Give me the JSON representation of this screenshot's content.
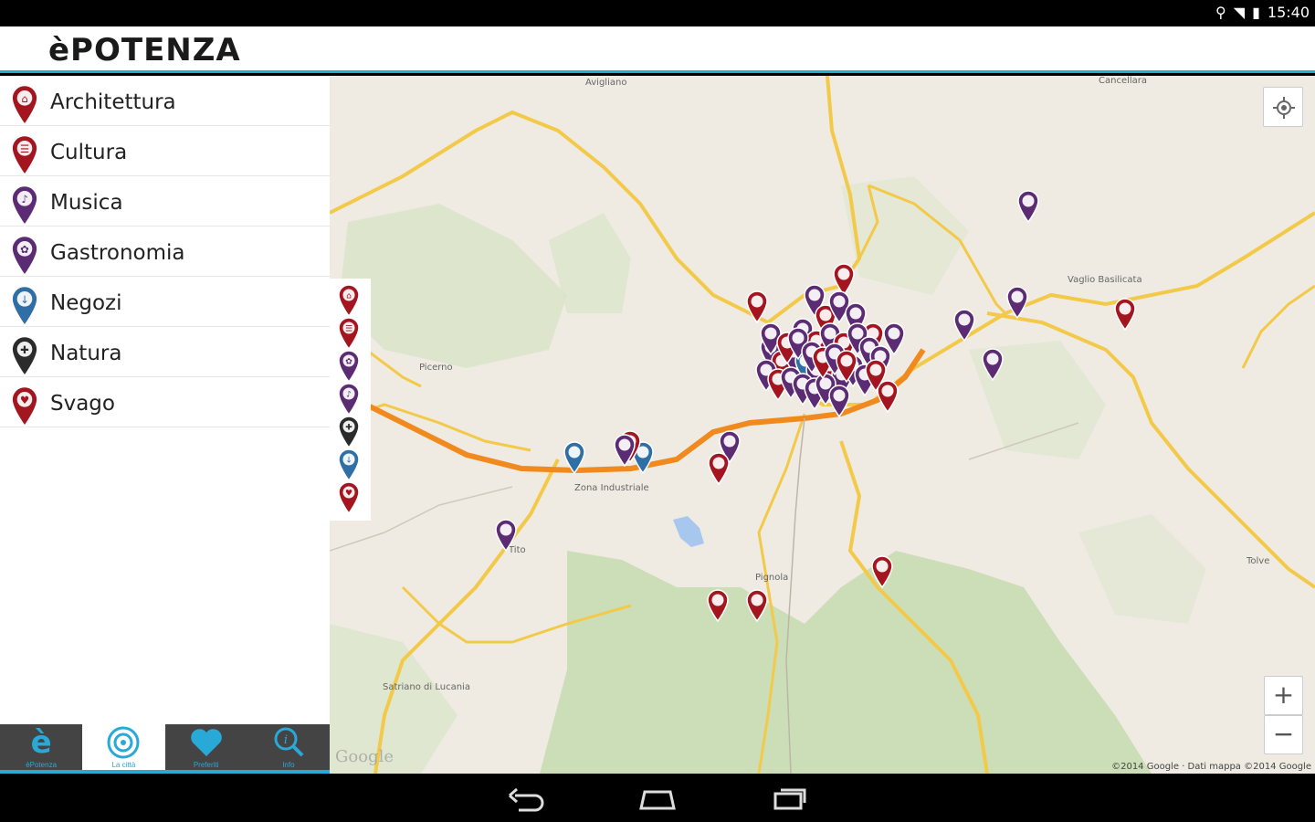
{
  "status": {
    "time": "15:40"
  },
  "app": {
    "title": "èPOTENZA"
  },
  "colors": {
    "accent": "#29a9d8",
    "architettura": "#a3151f",
    "cultura": "#a3151f",
    "musica": "#5b2c74",
    "gastronomia": "#5b2c74",
    "negozi": "#2f6fa6",
    "natura": "#2b2b2b",
    "svago": "#a3151f"
  },
  "categories": [
    {
      "label": "Architettura",
      "icon": "building-icon",
      "color": "#a3151f"
    },
    {
      "label": "Cultura",
      "icon": "theater-icon",
      "color": "#a3151f"
    },
    {
      "label": "Musica",
      "icon": "speaker-icon",
      "color": "#5b2c74"
    },
    {
      "label": "Gastronomia",
      "icon": "food-icon",
      "color": "#5b2c74"
    },
    {
      "label": "Negozi",
      "icon": "shop-icon",
      "color": "#2f6fa6"
    },
    {
      "label": "Natura",
      "icon": "leaf-icon",
      "color": "#2b2b2b"
    },
    {
      "label": "Svago",
      "icon": "fun-icon",
      "color": "#a3151f"
    }
  ],
  "tabs": [
    {
      "label": "èPotenza",
      "icon": "e-logo-icon",
      "active": false
    },
    {
      "label": "La città",
      "icon": "target-icon",
      "active": true
    },
    {
      "label": "Preferiti",
      "icon": "heart-icon",
      "active": false
    },
    {
      "label": "Info",
      "icon": "info-search-icon",
      "active": false
    }
  ],
  "map": {
    "place_labels": [
      "Avigliano",
      "Cancellara",
      "Vaglio Basilicata",
      "Picerno",
      "Zona Industriale",
      "Pignola",
      "Tito",
      "Satriano di Lucania",
      "Tolve"
    ],
    "zoom_in": "+",
    "zoom_out": "−",
    "copyright": "©2014 Google · Dati mappa ©2014 Google",
    "google_logo": "Google"
  }
}
